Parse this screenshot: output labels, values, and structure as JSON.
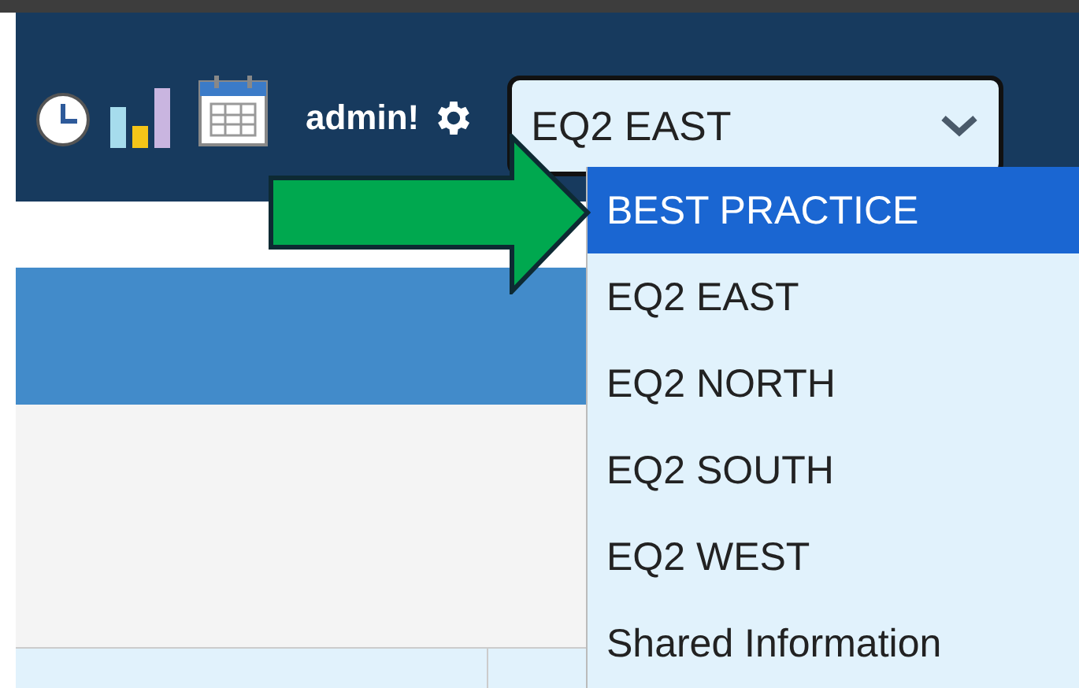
{
  "header": {
    "user": "admin!",
    "select": {
      "value": "EQ2 EAST",
      "expanded": true
    }
  },
  "options": [
    {
      "label": "BEST PRACTICE",
      "selected": true
    },
    {
      "label": "EQ2 EAST",
      "selected": false
    },
    {
      "label": "EQ2 NORTH",
      "selected": false
    },
    {
      "label": "EQ2 SOUTH",
      "selected": false
    },
    {
      "label": "EQ2 WEST",
      "selected": false
    },
    {
      "label": "Shared Information",
      "selected": false
    }
  ]
}
